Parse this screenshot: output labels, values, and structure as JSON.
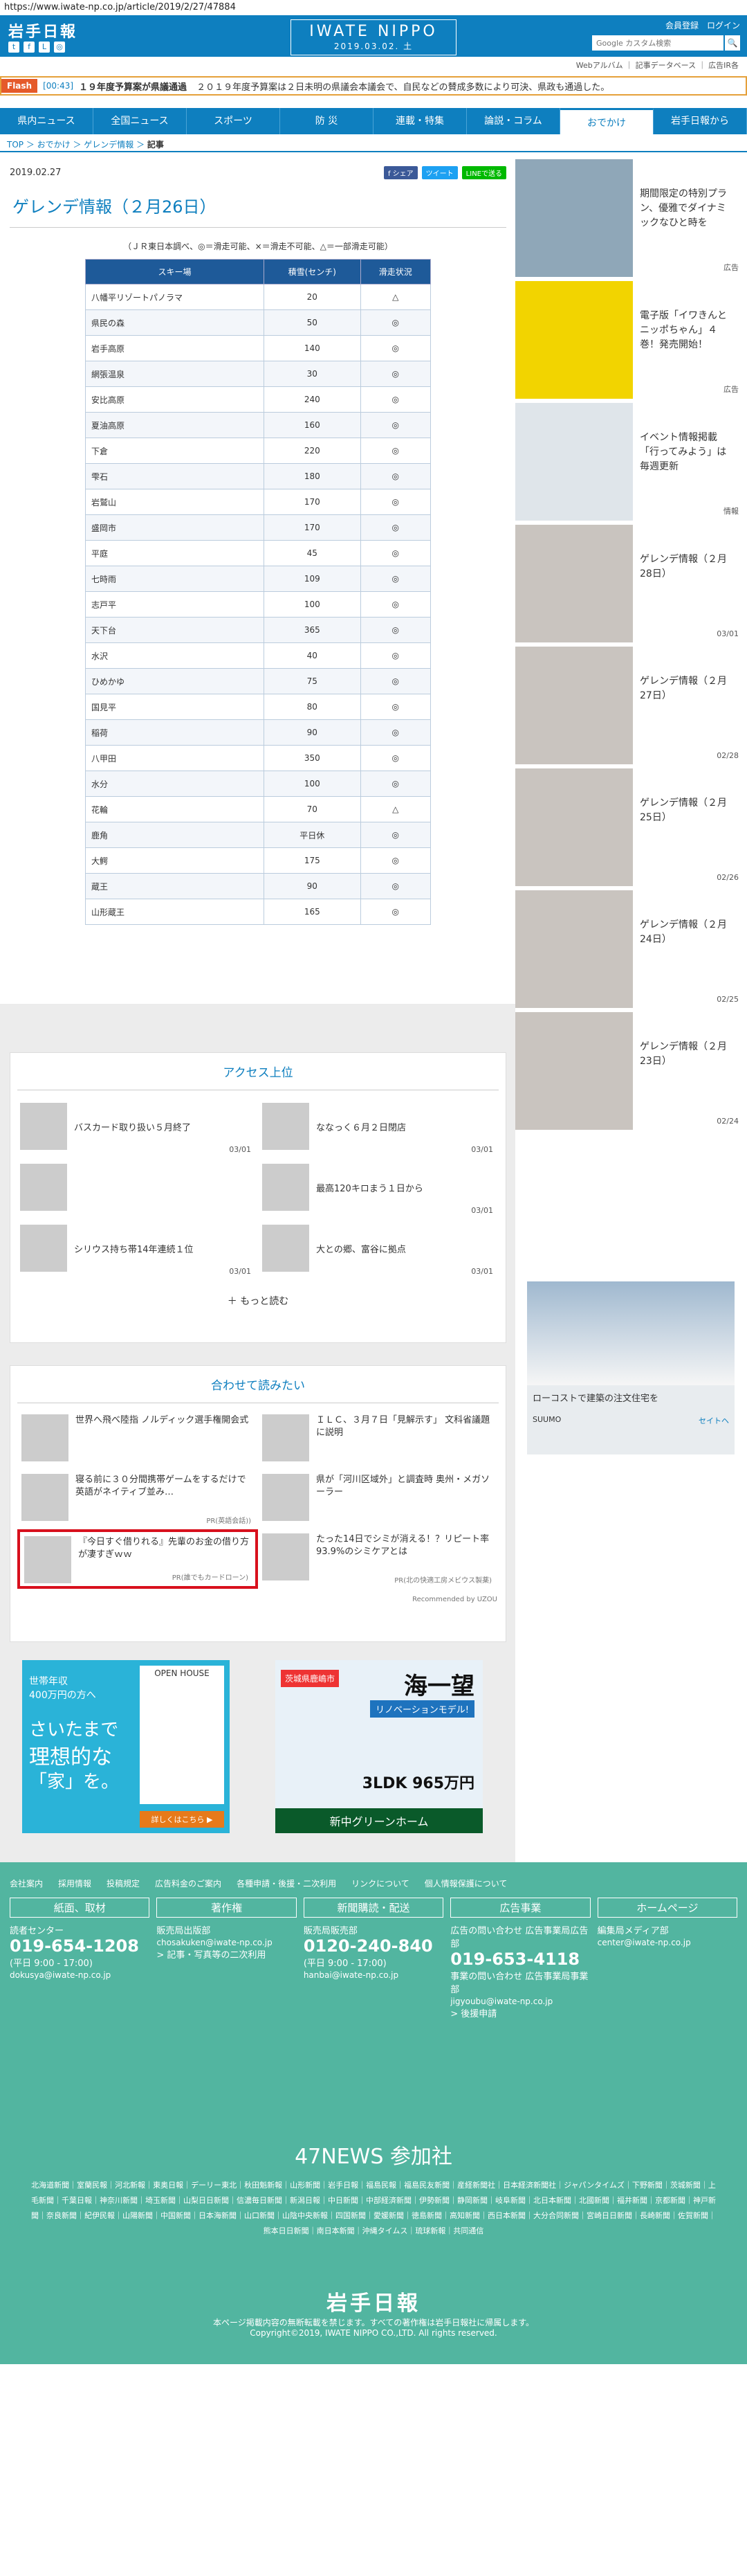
{
  "url": "https://www.iwate-np.co.jp/article/2019/2/27/47884",
  "header": {
    "logo": "岩手日報",
    "sns": [
      "t",
      "f",
      "L",
      "◎"
    ],
    "brand": "IWATE NIPPO",
    "date": "2019.03.02. 土",
    "links": "会員登録　ログイン",
    "search_placeholder": "Google カスタム検索",
    "search_button": "🔍"
  },
  "subnav": "Webアルバム ｜ 記事データベース ｜ 広告IR各",
  "flash": {
    "tag": "Flash",
    "time": "[00:43]",
    "headline": "１９年度予算案が県議通過",
    "text": "２０１９年度予算案は２日未明の県議会本議会で、自民などの賛成多数により可決、県政も通過した。"
  },
  "nav": [
    "県内ニュース",
    "全国ニュース",
    "スポーツ",
    "防 災",
    "連載・特集",
    "論説・コラム",
    "おでかけ",
    "岩手日報から"
  ],
  "nav_active": 6,
  "breadcrumb": {
    "trail": "TOP ＞ おでかけ ＞ ゲレンデ情報 ＞",
    "current": "記事"
  },
  "article": {
    "date": "2019.02.27",
    "share": [
      "f シェア",
      "ツイート",
      "LINEで送る"
    ],
    "title": "ゲレンデ情報（２月26日）",
    "note": "（ＪＲ東日本調べ、◎＝滑走可能、×＝滑走不可能、△＝一部滑走可能）",
    "table_headers": [
      "スキー場",
      "積雪(センチ)",
      "滑走状況"
    ],
    "rows": [
      [
        "八幡平リゾートパノラマ",
        "20",
        "△"
      ],
      [
        "県民の森",
        "50",
        "◎"
      ],
      [
        "岩手高原",
        "140",
        "◎"
      ],
      [
        "網張温泉",
        "30",
        "◎"
      ],
      [
        "安比高原",
        "240",
        "◎"
      ],
      [
        "夏油高原",
        "160",
        "◎"
      ],
      [
        "下倉",
        "220",
        "◎"
      ],
      [
        "雫石",
        "180",
        "◎"
      ],
      [
        "岩鷲山",
        "170",
        "◎"
      ],
      [
        "盛岡市",
        "170",
        "◎"
      ],
      [
        "平庭",
        "45",
        "◎"
      ],
      [
        "七時雨",
        "109",
        "◎"
      ],
      [
        "志戸平",
        "100",
        "◎"
      ],
      [
        "天下台",
        "365",
        "◎"
      ],
      [
        "水沢",
        "40",
        "◎"
      ],
      [
        "ひめかゆ",
        "75",
        "◎"
      ],
      [
        "国見平",
        "80",
        "◎"
      ],
      [
        "稲荷",
        "90",
        "◎"
      ],
      [
        "八甲田",
        "350",
        "◎"
      ],
      [
        "水分",
        "100",
        "◎"
      ],
      [
        "花輪",
        "70",
        "△"
      ],
      [
        "鹿角",
        "平日休",
        "◎"
      ],
      [
        "大鰐",
        "175",
        "◎"
      ],
      [
        "蔵王",
        "90",
        "◎"
      ],
      [
        "山形蔵王",
        "165",
        "◎"
      ]
    ]
  },
  "access": {
    "title": "アクセス上位",
    "items": [
      {
        "text": "バスカード取り扱い５月終了",
        "date": "03/01"
      },
      {
        "text": "ななっく６月２日閉店",
        "date": "03/01"
      },
      {
        "text": "",
        "date": ""
      },
      {
        "text": "最高120キロまう１日から",
        "date": "03/01"
      },
      {
        "text": "シリウス持ち帯14年連続１位",
        "date": "03/01"
      },
      {
        "text": "大との郷、富谷に拠点",
        "date": "03/01"
      }
    ],
    "more": "＋ もっと読む"
  },
  "related": {
    "title": "合わせて読みたい",
    "items": [
      {
        "text": "世界へ飛べ陸指 ノルディック選手権開会式",
        "pr": ""
      },
      {
        "text": "ＩＬＣ、３月７日「見解示す」 文科省議題に説明",
        "pr": ""
      },
      {
        "text": "寝る前に３０分間携帯ゲームをするだけで英語がネイティブ並み…",
        "pr": "PR(英語会話))"
      },
      {
        "text": "県が「河川区域外」と調査時 奥州・メガソーラー",
        "pr": ""
      },
      {
        "text": "『今日すぐ借りれる』先輩のお金の借り方が凄すぎｗｗ",
        "pr": "PR(誰でもカードローン)"
      },
      {
        "text": "たった14日でシミが消える！？リピート率93.9%のシミケアとは",
        "pr": "PR(北の快適工房メビウス製薬)"
      }
    ],
    "recby": "Recommended by UZOU"
  },
  "ads": {
    "ad1_lines": [
      "世帯年収",
      "400万円の方へ",
      "さいたまで",
      "理想的な",
      "「家」を。",
      "OPEN HOUSE",
      "詳しくはこちら ▶"
    ],
    "ad2_lines": [
      "海一望",
      "リノベーションモデル!",
      "3LDK 965万円",
      "茨城県鹿嶋市",
      "新中グリーンホーム"
    ],
    "side_ad": [
      "ローコストで建築の注文住宅を",
      "SUUMO",
      "セイトヘ"
    ]
  },
  "sidebar": [
    {
      "text": "期間限定の特別プラン、優雅でダイナミックなひと時を",
      "date": "広告",
      "img": "#8fa7b8"
    },
    {
      "text": "電子版「イワきんとニッポちゃん」４巻！発売開始！",
      "date": "広告",
      "img": "#f2d400"
    },
    {
      "text": "イベント情報掲載「行ってみよう」は毎週更新",
      "date": "情報",
      "img": "#dfe5ea"
    },
    {
      "text": "ゲレンデ情報（２月28日）",
      "date": "03/01",
      "img": "#c9c4bf"
    },
    {
      "text": "ゲレンデ情報（２月27日）",
      "date": "02/28",
      "img": "#c9c4bf"
    },
    {
      "text": "ゲレンデ情報（２月25日）",
      "date": "02/26",
      "img": "#c9c4bf"
    },
    {
      "text": "ゲレンデ情報（２月24日）",
      "date": "02/25",
      "img": "#c9c4bf"
    },
    {
      "text": "ゲレンデ情報（２月23日）",
      "date": "02/24",
      "img": "#c9c4bf"
    }
  ],
  "footer": {
    "links": [
      "会社案内",
      "採用情報",
      "投稿規定",
      "広告料金のご案内",
      "各種申請・後援・二次利用",
      "リンクについて",
      "個人情報保護について"
    ],
    "cols": [
      {
        "head": "紙面、取材",
        "lines": [
          "読者センター",
          "019-654-1208",
          "(平日 9:00 - 17:00)",
          "dokusya@iwate-np.co.jp"
        ]
      },
      {
        "head": "著作権",
        "lines": [
          "販売局出版部",
          "chosakuken@iwate-np.co.jp",
          "> 記事・写真等の二次利用"
        ]
      },
      {
        "head": "新聞購読・配送",
        "lines": [
          "販売局販売部",
          "0120-240-840",
          "(平日 9:00 - 17:00)",
          "hanbai@iwate-np.co.jp"
        ]
      },
      {
        "head": "広告事業",
        "lines": [
          "広告の問い合わせ 広告事業局広告部",
          "019-653-4118",
          "事業の問い合わせ 広告事業局事業部",
          "jigyoubu@iwate-np.co.jp",
          "> 後援申請"
        ]
      },
      {
        "head": "ホームページ",
        "lines": [
          "編集局メディア部",
          "center@iwate-np.co.jp"
        ]
      }
    ],
    "news47_title": "47NEWS 参加社",
    "papers": "北海道新聞｜室蘭民報｜河北新報｜東奥日報｜デーリー東北｜秋田魁新報｜山形新聞｜岩手日報｜福島民報｜福島民友新聞｜産経新聞社｜日本経済新聞社｜ジャパンタイムズ｜下野新聞｜茨城新聞｜上毛新聞｜千葉日報｜神奈川新聞｜埼玉新聞｜山梨日日新聞｜信濃毎日新聞｜新潟日報｜中日新聞｜中部経済新聞｜伊勢新聞｜静岡新聞｜岐阜新聞｜北日本新聞｜北國新聞｜福井新聞｜京都新聞｜神戸新聞｜奈良新聞｜紀伊民報｜山陽新聞｜中国新聞｜日本海新聞｜山口新聞｜山陰中央新報｜四国新聞｜愛媛新聞｜徳島新聞｜高知新聞｜西日本新聞｜大分合同新聞｜宮崎日日新聞｜長崎新聞｜佐賀新聞｜熊本日日新聞｜南日本新聞｜沖縄タイムス｜琉球新報｜共同通信",
    "logo": "岩手日報",
    "rights": "本ページ掲載内容の無断転載を禁じます。すべての著作権は岩手日報社に帰属します。",
    "copyright": "Copyright©2019, IWATE NIPPO CO.,LTD. All rights reserved."
  }
}
